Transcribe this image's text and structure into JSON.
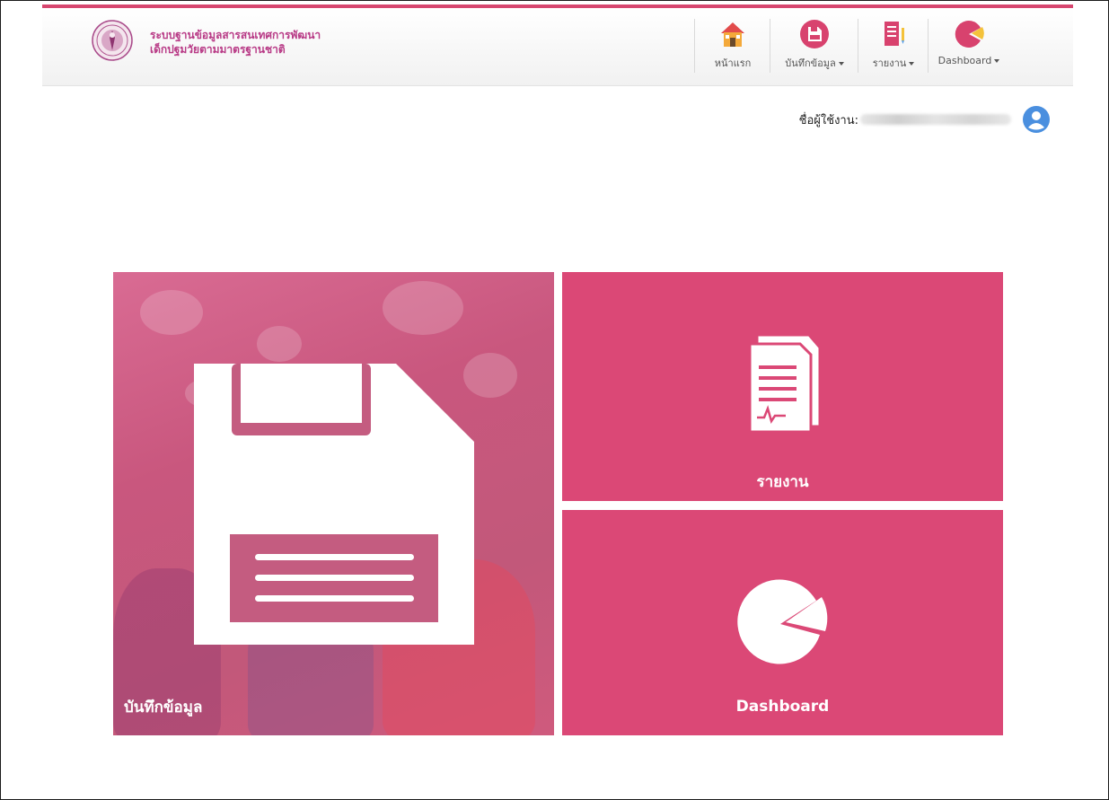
{
  "brand": {
    "line1": "ระบบฐานข้อมูลสารสนเทศการพัฒนา",
    "line2": "เด็กปฐมวัยตามมาตรฐานชาติ",
    "logo_icon": "royal-seal-icon"
  },
  "nav": {
    "home": {
      "label": "หน้าแรก",
      "icon": "home-icon"
    },
    "record": {
      "label": "บันทึกข้อมูล",
      "icon": "floppy-disk-icon"
    },
    "report": {
      "label": "รายงาน",
      "icon": "report-document-icon"
    },
    "dashboard": {
      "label": "Dashboard",
      "icon": "pie-chart-icon"
    }
  },
  "user": {
    "label": "ชื่อผู้ใช้งาน:",
    "name": "xxxxxxxxxxxxxxxxxxxxxxxxxxxx",
    "icon": "user-circle-icon"
  },
  "tiles": {
    "record": {
      "label": "บันทึกข้อมูล",
      "icon": "floppy-disk-icon"
    },
    "report": {
      "label": "รายงาน",
      "icon": "report-document-icon"
    },
    "dashboard": {
      "label": "Dashboard",
      "icon": "pie-chart-icon"
    }
  },
  "colors": {
    "accent": "#db4876",
    "brand_text": "#b83a86",
    "user_icon": "#4a8fdf"
  }
}
